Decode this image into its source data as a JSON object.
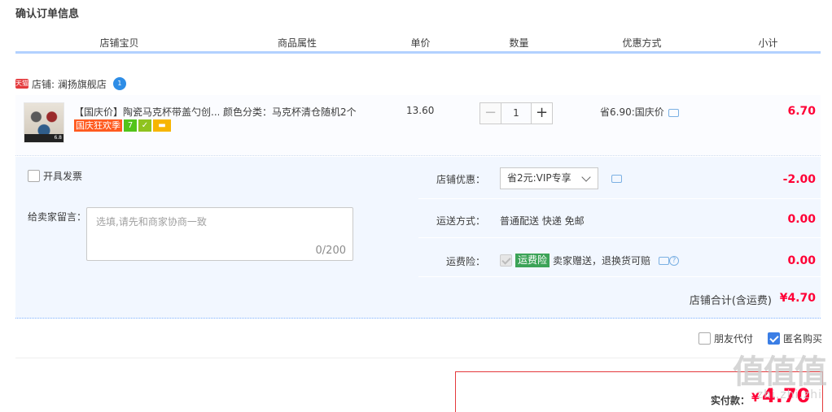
{
  "page": {
    "title": "确认订单信息"
  },
  "table_header": {
    "columns": [
      "店铺宝贝",
      "商品属性",
      "单价",
      "数量",
      "优惠方式",
      "小计"
    ]
  },
  "shop": {
    "badge": "天猫",
    "label": "店铺: 澜扬旗舰店",
    "ww_badge": "1"
  },
  "item": {
    "title": "【国庆价】陶瓷马克杯带盖勺创...",
    "promo_tag": "国庆狂欢季",
    "promo_badge_7": "7",
    "thumb_tag": "6.8",
    "property": "颜色分类：马克杯清仓随机2个",
    "unit_price": "13.60",
    "qty_minus": "−",
    "qty_value": "1",
    "qty_plus": "+",
    "discount": "省6.90:国庆价",
    "subtotal": "6.70"
  },
  "options": {
    "invoice_label": "开具发票",
    "memo_label": "给卖家留言：",
    "memo_placeholder": "选填,请先和商家协商一致",
    "memo_count": "0/200",
    "shop_discount_label": "店铺优惠：",
    "shop_discount_value": "省2元:VIP专享",
    "shop_discount_amount": "-2.00",
    "shipping_label": "运送方式：",
    "shipping_value": "普通配送 快递 免邮",
    "shipping_amount": "0.00",
    "insurance_label": "运费险：",
    "insurance_tag": "运费险",
    "insurance_text": "卖家赠送，退换货可赔",
    "insurance_amount": "0.00",
    "shop_total_label": "店铺合计(含运费)",
    "shop_total_amount": "¥4.70"
  },
  "bottom": {
    "friend_pay": "朋友代付",
    "anonymous": "匿名购买"
  },
  "pay": {
    "label": "实付款：",
    "currency": "¥",
    "amount": "4.70"
  },
  "watermark": {
    "text": "值值值",
    "sub": "zhi.zhi.zhi"
  },
  "colors": {
    "price_red": "#ff0036",
    "accent_blue": "#3b7ee5",
    "header_line": "#b2d1ff",
    "panel_bg": "#f2f7ff"
  }
}
